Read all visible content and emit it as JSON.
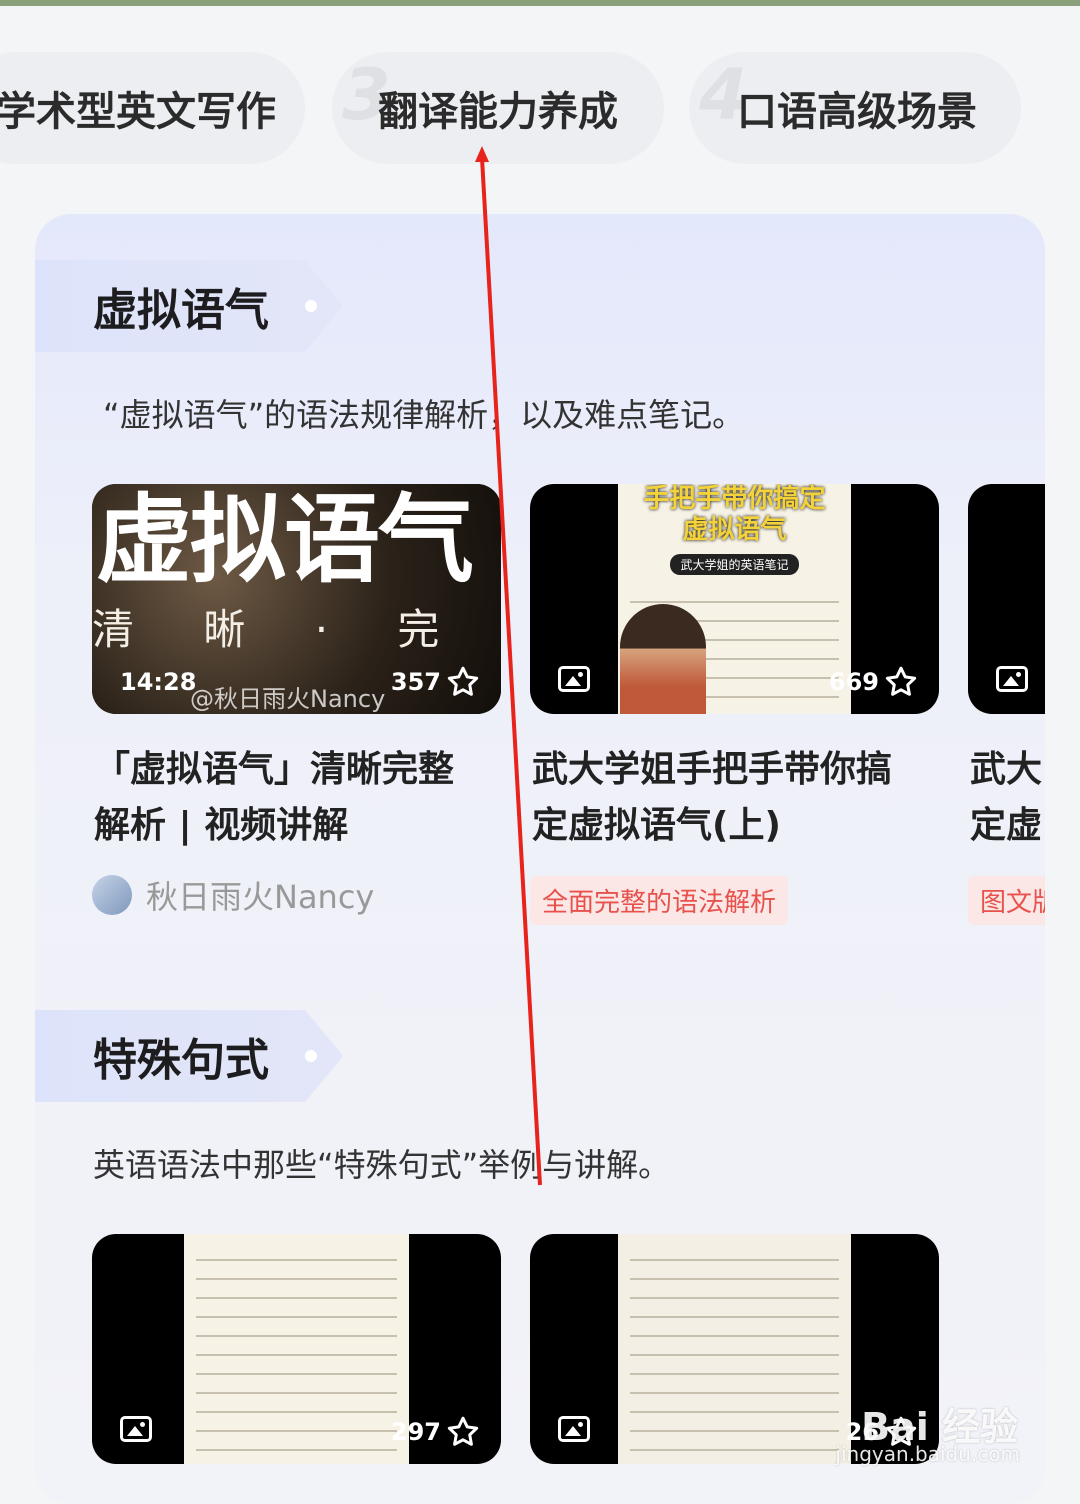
{
  "tabs": [
    {
      "label": "学术型英文写作",
      "num": ""
    },
    {
      "label": "翻译能力养成",
      "num": "3"
    },
    {
      "label": "口语高级场景",
      "num": "4"
    }
  ],
  "sections": [
    {
      "title": "虚拟语气",
      "description": "“虚拟语气”的语法规律解析，以及难点笔记。",
      "cards": [
        {
          "cover_big": "虚拟语气",
          "cover_small": "清 晰 · 完 整 解 析",
          "cover_watermark": "@秋日雨火Nancy",
          "duration": "14:28",
          "likes": "357",
          "title_line1": "「虚拟语气」清晰完整",
          "title_line2": "解析 | 视频讲解",
          "author": "秋日雨火Nancy"
        },
        {
          "cover_head1": "手把手带你搞定",
          "cover_head2": "虚拟语气",
          "cover_head3": "武大学姐的英语笔记",
          "likes": "669",
          "title_line1": "武大学姐手把手带你搞",
          "title_line2": "定虚拟语气(上)",
          "tag": "全面完整的语法解析"
        },
        {
          "title_line1": "武大",
          "title_line2": "定虚",
          "tag": "图文版"
        }
      ]
    },
    {
      "title": "特殊句式",
      "description": "英语语法中那些“特殊句式”举例与讲解。",
      "cards": [
        {
          "likes": "297"
        },
        {
          "likes": "26"
        }
      ]
    }
  ],
  "watermark": {
    "brand": "Bai 经验",
    "url": "jingyan.baidu.com"
  },
  "colors": {
    "tag_red": "#e8524d",
    "annotation_arrow": "#e8231c"
  }
}
